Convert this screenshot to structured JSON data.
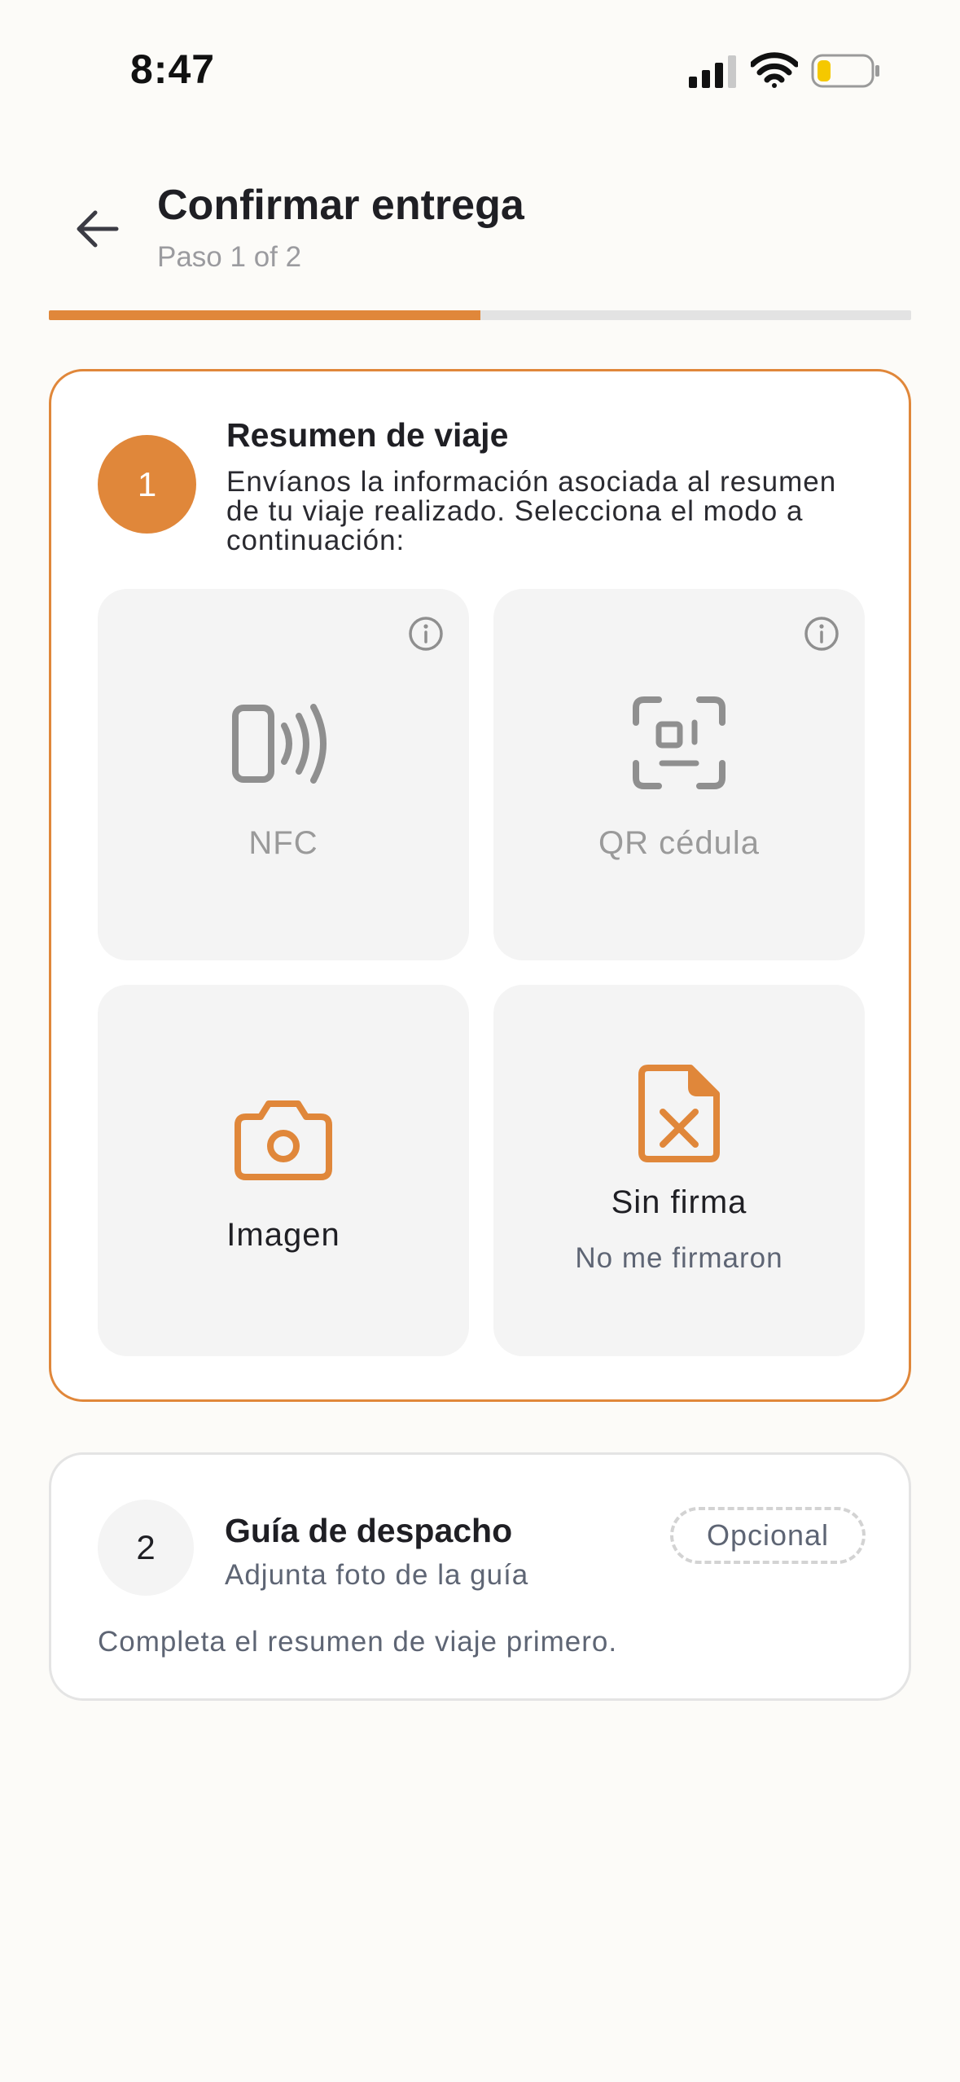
{
  "status_bar": {
    "time": "8:47"
  },
  "header": {
    "title": "Confirmar entrega",
    "step": "Paso 1 of 2",
    "progress": 0.5
  },
  "colors": {
    "accent": "#e0873a",
    "muted_text": "#5e6574",
    "disabled_icon": "#8f8f8f",
    "card_bg": "#f4f4f4"
  },
  "step1": {
    "number": "1",
    "title": "Resumen de viaje",
    "description": "Envíanos la información asociada al resumen de tu viaje realizado. Selecciona el modo a continuación:",
    "options": {
      "nfc": {
        "label": "NFC",
        "icon": "nfc-icon",
        "enabled": false
      },
      "qr": {
        "label": "QR cédula",
        "icon": "qr-scan-icon",
        "enabled": false
      },
      "image": {
        "label": "Imagen",
        "icon": "camera-icon",
        "enabled": true
      },
      "no_signature": {
        "label": "Sin firma",
        "sub": "No me firmaron",
        "icon": "file-x-icon",
        "enabled": true
      }
    }
  },
  "step2": {
    "number": "2",
    "title": "Guía de despacho",
    "subtitle": "Adjunta foto de la guía",
    "badge": "Opcional",
    "note": "Completa el resumen de viaje primero."
  }
}
